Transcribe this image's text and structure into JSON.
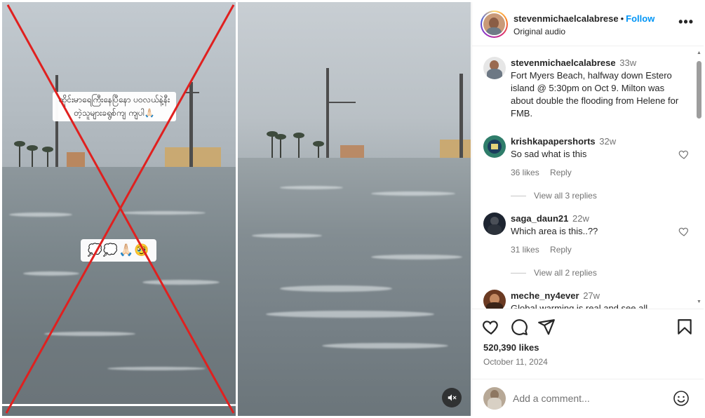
{
  "left_frame": {
    "overlay_caption": "ထိုင်းမာရေကြီးနေပြီနော ပဝလယ်နဲ့နီးတဲ့သူများခရွစ်ကျ ကျပါ🙏🏻",
    "overlay_emoji": "💭💭🙏🏻🥹",
    "progress_fraction": 0.98
  },
  "video": {
    "mute_icon": "speaker-muted-icon"
  },
  "post": {
    "author": "stevenmichaelcalabrese",
    "separator": "•",
    "follow_label": "Follow",
    "audio_label": "Original audio",
    "more_icon": "more-horizontal-icon",
    "more_label": "•••"
  },
  "comments": [
    {
      "user": "stevenmichaelcalabrese",
      "time": "33w",
      "text": "Fort Myers Beach, halfway down Estero island @ 5:30pm on Oct 9. Milton was about double the flooding from Helene for FMB."
    },
    {
      "user": "krishkapapershorts",
      "time": "32w",
      "text": "So sad what is this",
      "likes": "36 likes",
      "reply": "Reply",
      "view_replies": "View all 3 replies"
    },
    {
      "user": "saga_daun21",
      "time": "22w",
      "text": "Which area is this..??",
      "likes": "31 likes",
      "reply": "Reply",
      "view_replies": "View all 2 replies"
    },
    {
      "user": "meche_ny4ever",
      "time": "27w",
      "text": "Global warming is real and see all"
    }
  ],
  "actions": {
    "like_icon": "heart-icon",
    "comment_icon": "comment-icon",
    "share_icon": "send-icon",
    "save_icon": "bookmark-icon"
  },
  "likes_count": "520,390 likes",
  "date": "October 11, 2024",
  "add_comment": {
    "placeholder": "Add a comment...",
    "emoji_icon": "smiley-icon"
  },
  "colors": {
    "follow_blue": "#0095f6",
    "cross_red": "#e0201f",
    "text_primary": "#262626",
    "text_secondary": "#737373"
  }
}
